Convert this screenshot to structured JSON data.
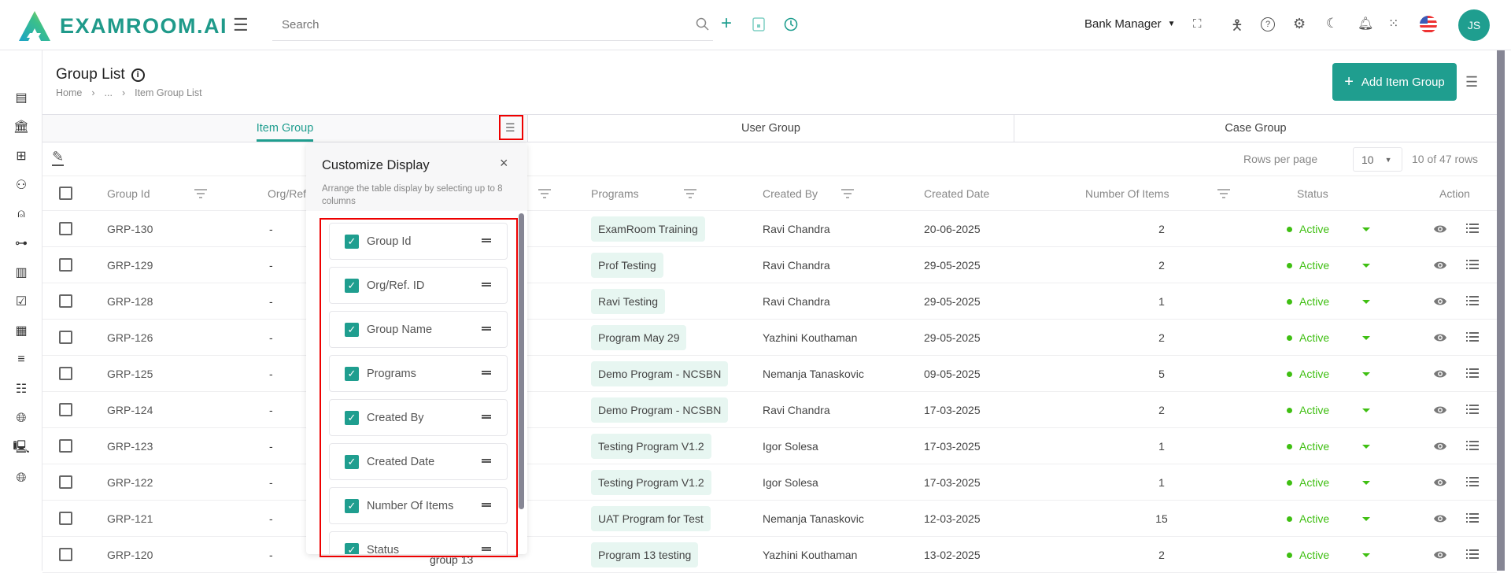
{
  "app": {
    "brand": "EXAMROOM.AI",
    "search_placeholder": "Search",
    "role": "Bank Manager",
    "avatar_initials": "JS"
  },
  "page": {
    "title": "Group List",
    "breadcrumb": [
      "Home",
      "...",
      "Item Group List"
    ],
    "add_button": "Add Item Group"
  },
  "tabs": [
    {
      "label": "Item Group",
      "active": true
    },
    {
      "label": "User Group"
    },
    {
      "label": "Case Group"
    }
  ],
  "pagination": {
    "rows_per_page_label": "Rows per page",
    "rows_per_page": "10",
    "summary": "10 of 47 rows"
  },
  "columns": {
    "group_id": "Group Id",
    "org_ref": "Org/Ref",
    "programs": "Programs",
    "created_by": "Created By",
    "created_date": "Created Date",
    "number_of_items": "Number Of Items",
    "status": "Status",
    "action": "Action"
  },
  "rows": [
    {
      "id": "GRP-130",
      "org": "-",
      "name": "",
      "program": "ExamRoom Training",
      "by": "Ravi Chandra",
      "date": "20-06-2025",
      "items": "2",
      "status": "Active"
    },
    {
      "id": "GRP-129",
      "org": "-",
      "name": "",
      "program": "Prof Testing",
      "by": "Ravi Chandra",
      "date": "29-05-2025",
      "items": "2",
      "status": "Active"
    },
    {
      "id": "GRP-128",
      "org": "-",
      "name": "",
      "program": "Ravi Testing",
      "by": "Ravi Chandra",
      "date": "29-05-2025",
      "items": "1",
      "status": "Active"
    },
    {
      "id": "GRP-126",
      "org": "-",
      "name": "",
      "program": "Program May 29",
      "by": "Yazhini Kouthaman",
      "date": "29-05-2025",
      "items": "2",
      "status": "Active"
    },
    {
      "id": "GRP-125",
      "org": "-",
      "name": "",
      "program": "Demo Program - NCSBN",
      "by": "Nemanja Tanaskovic",
      "date": "09-05-2025",
      "items": "5",
      "status": "Active"
    },
    {
      "id": "GRP-124",
      "org": "-",
      "name": "",
      "program": "Demo Program - NCSBN",
      "by": "Ravi Chandra",
      "date": "17-03-2025",
      "items": "2",
      "status": "Active"
    },
    {
      "id": "GRP-123",
      "org": "-",
      "name": "",
      "program": "Testing Program V1.2",
      "by": "Igor Solesa",
      "date": "17-03-2025",
      "items": "1",
      "status": "Active"
    },
    {
      "id": "GRP-122",
      "org": "-",
      "name": "",
      "program": "Testing Program V1.2",
      "by": "Igor Solesa",
      "date": "17-03-2025",
      "items": "1",
      "status": "Active"
    },
    {
      "id": "GRP-121",
      "org": "-",
      "name": "",
      "program": "UAT Program for Test",
      "by": "Nemanja Tanaskovic",
      "date": "12-03-2025",
      "items": "15",
      "status": "Active"
    },
    {
      "id": "GRP-120",
      "org": "-",
      "name": "group 13",
      "program": "Program 13 testing",
      "by": "Yazhini Kouthaman",
      "date": "13-02-2025",
      "items": "2",
      "status": "Active"
    }
  ],
  "customize": {
    "title": "Customize Display",
    "close": "×",
    "description": "Arrange the table display by selecting up to 8 columns",
    "items": [
      {
        "label": "Group Id",
        "checked": true
      },
      {
        "label": "Org/Ref. ID",
        "checked": true
      },
      {
        "label": "Group Name",
        "checked": true
      },
      {
        "label": "Programs",
        "checked": true
      },
      {
        "label": "Created By",
        "checked": true
      },
      {
        "label": "Created Date",
        "checked": true
      },
      {
        "label": "Number Of Items",
        "checked": true
      },
      {
        "label": "Status",
        "checked": true
      }
    ]
  },
  "colors": {
    "accent": "#1f9e8f",
    "active": "#3fbf12",
    "chip": "#e7f6f1",
    "highlight": "#e00000"
  }
}
